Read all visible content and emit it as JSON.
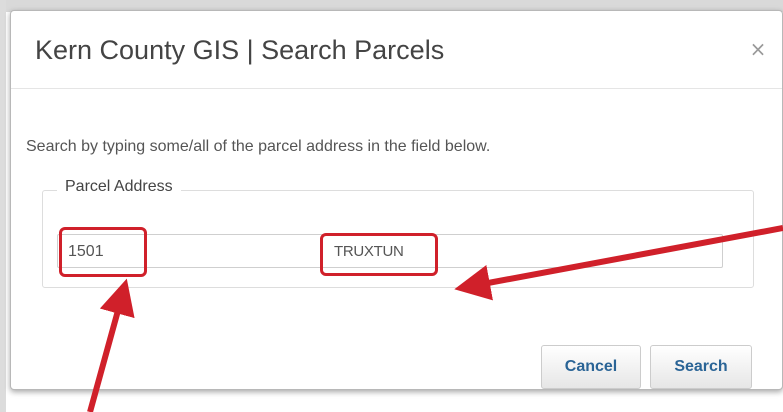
{
  "dialog": {
    "title": "Kern County GIS | Search Parcels",
    "close_glyph": "×",
    "instructions": "Search by typing some/all of the parcel address in the field below.",
    "fieldset_legend": "Parcel Address",
    "address_number": "1501",
    "address_street": "TRUXTUN",
    "cancel_label": "Cancel",
    "search_label": "Search"
  },
  "annotations": {
    "highlight_color": "#d0202a"
  },
  "colors": {
    "link_blue": "#2a6496",
    "text_gray": "#555555",
    "title_gray": "#444444"
  }
}
